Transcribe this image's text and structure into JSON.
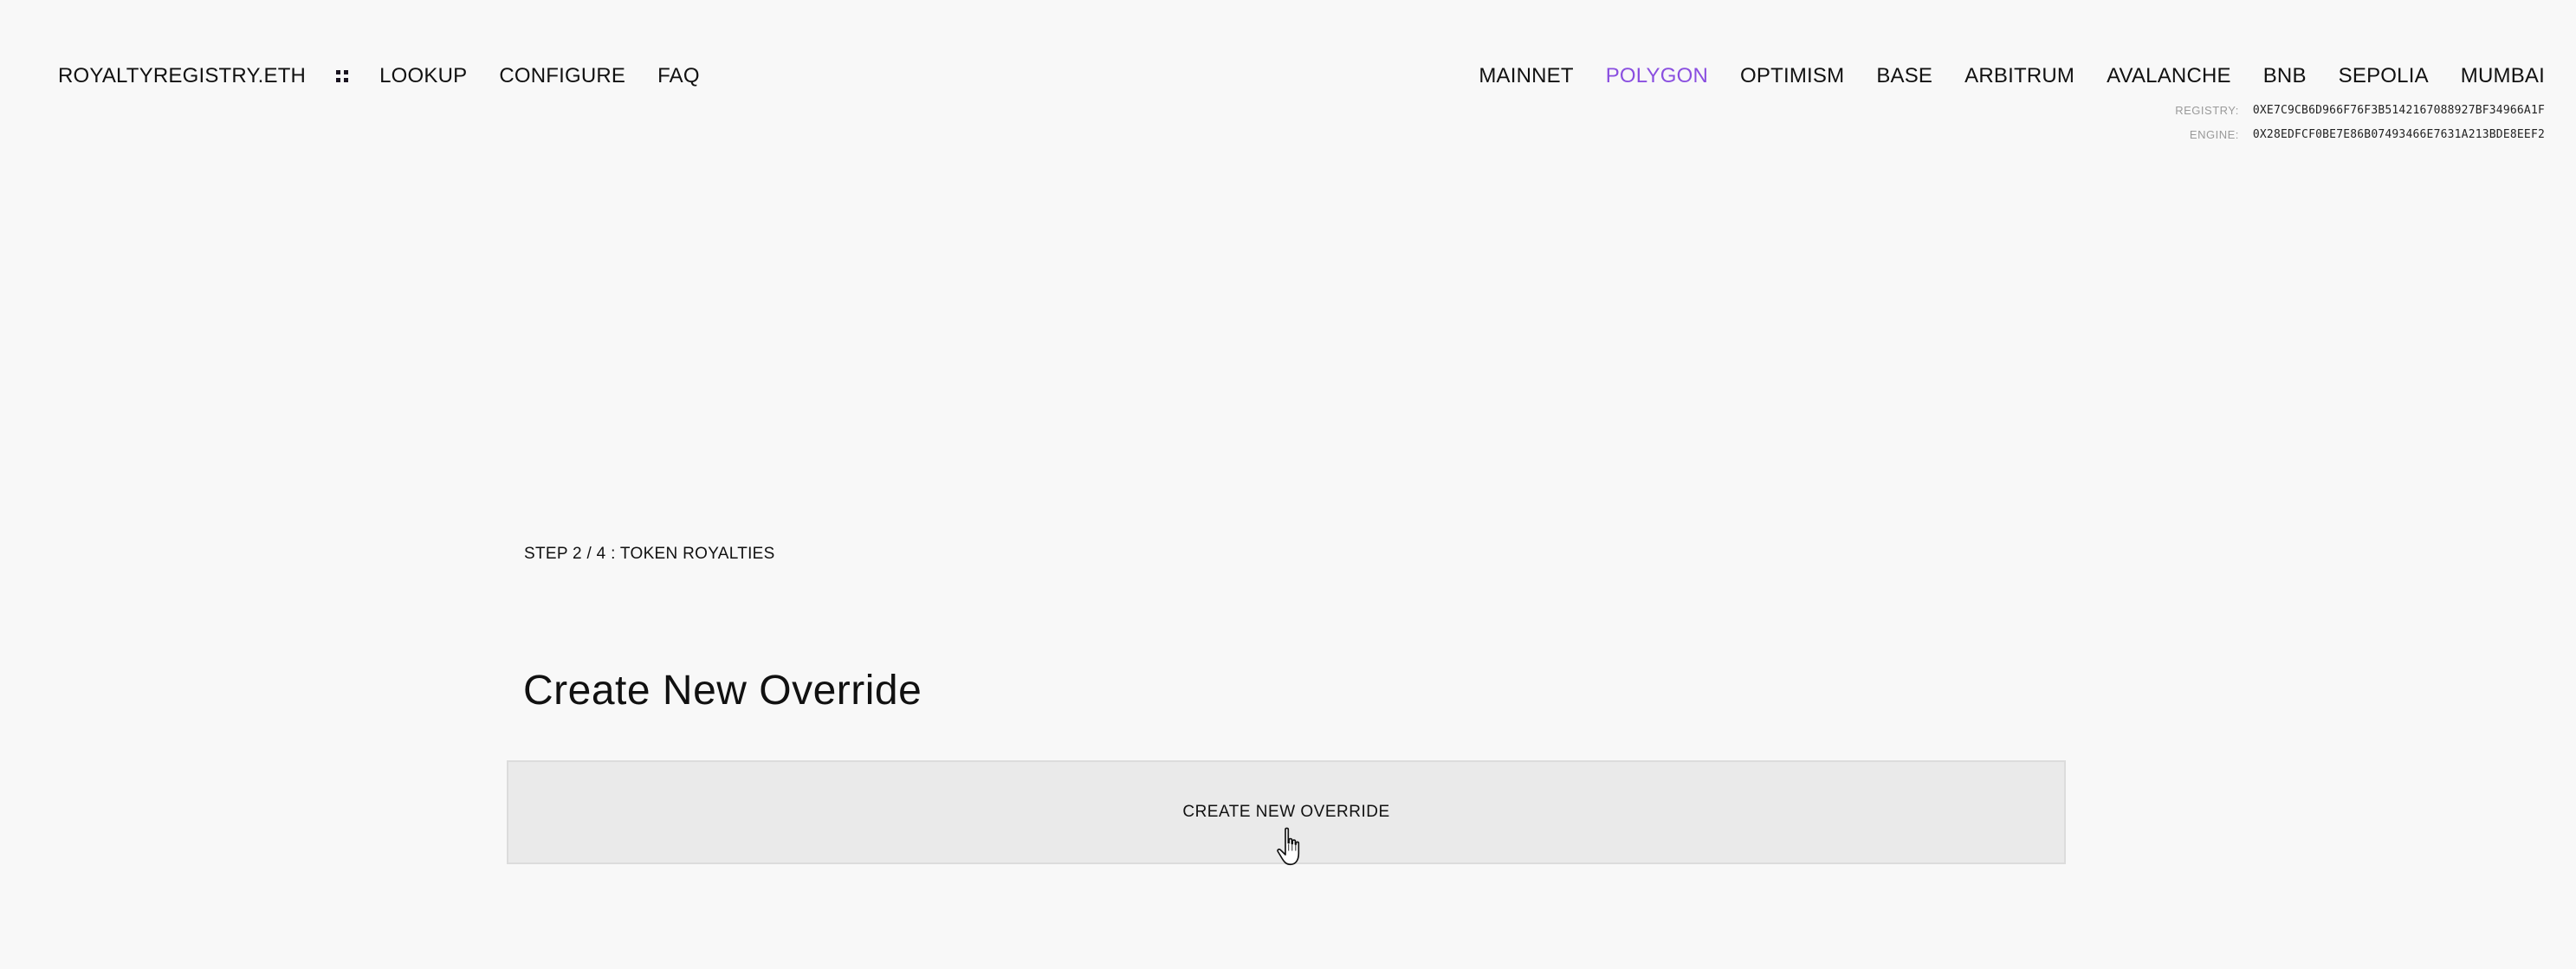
{
  "header": {
    "brand": "ROYALTYREGISTRY.ETH",
    "menu_icon": "grid-dots-icon",
    "nav_links": [
      {
        "label": "LOOKUP"
      },
      {
        "label": "CONFIGURE"
      },
      {
        "label": "FAQ"
      }
    ],
    "networks": [
      {
        "label": "MAINNET",
        "active": false
      },
      {
        "label": "POLYGON",
        "active": true
      },
      {
        "label": "OPTIMISM",
        "active": false
      },
      {
        "label": "BASE",
        "active": false
      },
      {
        "label": "ARBITRUM",
        "active": false
      },
      {
        "label": "AVALANCHE",
        "active": false
      },
      {
        "label": "BNB",
        "active": false
      },
      {
        "label": "SEPOLIA",
        "active": false
      },
      {
        "label": "MUMBAI",
        "active": false
      }
    ],
    "active_color": "#8a4fe0",
    "addresses": {
      "registry_label": "REGISTRY:",
      "registry_value": "0XE7C9CB6D966F76F3B5142167088927BF34966A1F",
      "engine_label": "ENGINE:",
      "engine_value": "0X28EDFCF0BE7E86B07493466E7631A213BDE8EEF2"
    }
  },
  "main": {
    "step_label": "STEP 2 / 4 : TOKEN ROYALTIES",
    "title": "Create New Override",
    "create_button_label": "CREATE NEW OVERRIDE"
  },
  "cursor": {
    "icon": "hand-pointer-cursor-icon"
  }
}
